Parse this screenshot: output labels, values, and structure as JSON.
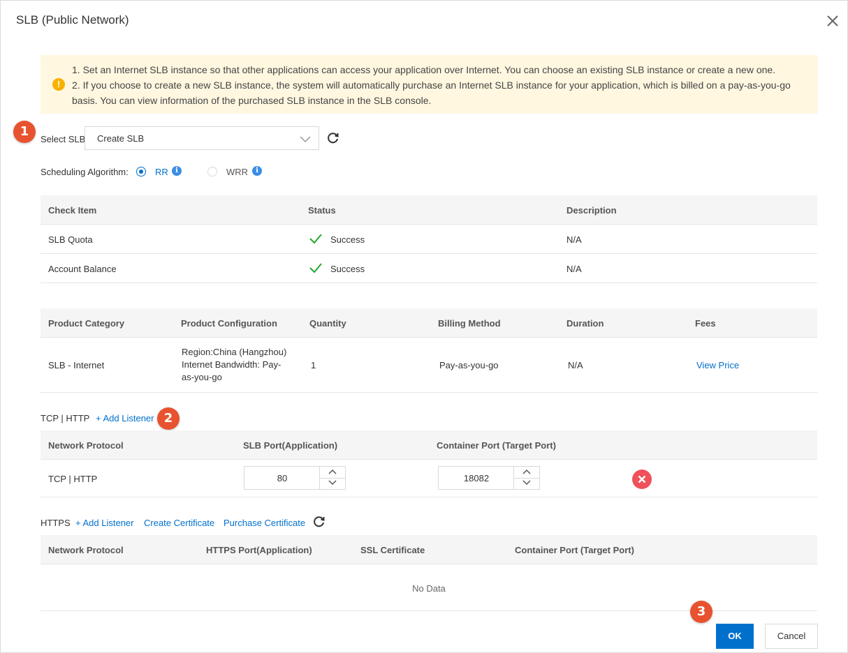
{
  "dialog": {
    "title": "SLB (Public Network)",
    "close_icon": "close-icon"
  },
  "notice": {
    "icon": "warning-icon",
    "line1": "1. Set an Internet SLB instance so that other applications can access your application over Internet. You can choose an existing SLB instance or create a new one.",
    "line2": "2. If you choose to create a new SLB instance, the system will automatically purchase an Internet SLB instance for your application, which is billed on a pay-as-you-go basis. You can view information of the purchased SLB instance in the SLB console."
  },
  "badges": {
    "b1": "1",
    "b2": "2",
    "b3": "3"
  },
  "select_slb": {
    "label": "Select SLB:",
    "value": "Create SLB"
  },
  "scheduling": {
    "label": "Scheduling Algorithm:",
    "options": [
      {
        "label": "RR",
        "selected": true
      },
      {
        "label": "WRR",
        "selected": false
      }
    ]
  },
  "check_table": {
    "headers": [
      "Check Item",
      "Status",
      "Description"
    ],
    "rows": [
      {
        "item": "SLB Quota",
        "status": "Success",
        "description": "N/A"
      },
      {
        "item": "Account Balance",
        "status": "Success",
        "description": "N/A"
      }
    ]
  },
  "product_table": {
    "headers": [
      "Product Category",
      "Product Configuration",
      "Quantity",
      "Billing Method",
      "Duration",
      "Fees"
    ],
    "row": {
      "category": "SLB - Internet",
      "config_line1": "Region:China (Hangzhou)",
      "config_line2": "Internet Bandwidth: Pay-",
      "config_line3": "as-you-go",
      "quantity": "1",
      "billing": "Pay-as-you-go",
      "duration": "N/A",
      "fees": "View Price"
    }
  },
  "tcp": {
    "section_label": "TCP | HTTP",
    "add_listener": "+ Add Listener",
    "headers": [
      "Network Protocol",
      "SLB Port(Application)",
      "Container Port (Target Port)"
    ],
    "row": {
      "protocol": "TCP | HTTP",
      "slb_port": "80",
      "container_port": "18082"
    }
  },
  "https": {
    "section_label": "HTTPS",
    "add_listener": "+ Add Listener",
    "create_cert": "Create Certificate",
    "purchase_cert": "Purchase Certificate",
    "headers": [
      "Network Protocol",
      "HTTPS Port(Application)",
      "SSL Certificate",
      "Container Port (Target Port)"
    ],
    "empty": "No Data"
  },
  "footer": {
    "ok": "OK",
    "cancel": "Cancel"
  },
  "colors": {
    "primary": "#0070cc",
    "badge": "#e8522f",
    "success": "#22a832",
    "danger": "#f0505a",
    "notice_bg": "#fff7e0"
  }
}
